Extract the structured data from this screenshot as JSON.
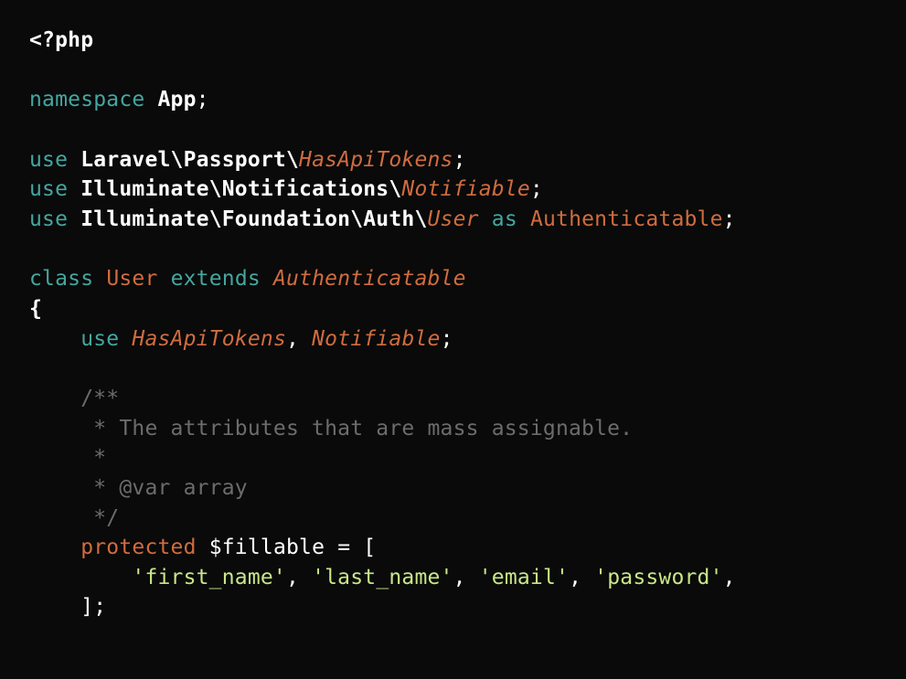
{
  "code": {
    "l1_open": "<?php",
    "l3_ns": "namespace",
    "l3_app": "App",
    "l5_use": "use",
    "l5_path": "Laravel\\Passport\\",
    "l5_cls": "HasApiTokens",
    "l6_use": "use",
    "l6_path": "Illuminate\\Notifications\\",
    "l6_cls": "Notifiable",
    "l7_use": "use",
    "l7_path": "Illuminate\\Foundation\\Auth\\",
    "l7_cls": "User",
    "l7_as": "as",
    "l7_alias": "Authenticatable",
    "l9_class": "class",
    "l9_name": "User",
    "l9_extends": "extends",
    "l9_parent": "Authenticatable",
    "l10_brace": "{",
    "l11_use": "use",
    "l11_t1": "HasApiTokens",
    "l11_t2": "Notifiable",
    "l13_c": "/**",
    "l14_c": " * The attributes that are mass assignable.",
    "l15_c": " *",
    "l16_c": " * @var array",
    "l17_c": " */",
    "l18_prot": "protected",
    "l18_var": "$fillable",
    "l18_eq": " = [",
    "l19_s1": "'first_name'",
    "l19_s2": "'last_name'",
    "l19_s3": "'email'",
    "l19_s4": "'password'",
    "l20_close": "];"
  }
}
